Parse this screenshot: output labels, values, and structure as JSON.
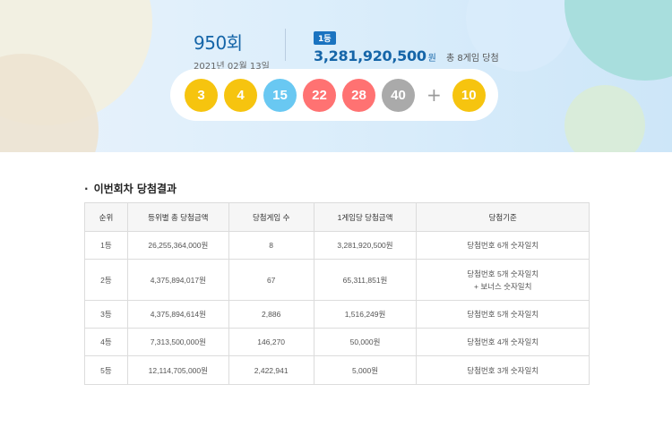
{
  "draw": {
    "round": "950회",
    "date": "2021년 02월 13일",
    "first_prize": {
      "badge": "1등",
      "amount": "3,281,920,500",
      "unit": "원",
      "winners_text": "총 8게임 당첨"
    },
    "numbers": [
      {
        "value": "3",
        "color": "yellow"
      },
      {
        "value": "4",
        "color": "yellow"
      },
      {
        "value": "15",
        "color": "blue"
      },
      {
        "value": "22",
        "color": "red"
      },
      {
        "value": "28",
        "color": "red"
      },
      {
        "value": "40",
        "color": "gray"
      }
    ],
    "plus": "+",
    "bonus": {
      "value": "10",
      "color": "yellow"
    }
  },
  "results": {
    "title": "이번회차 당첨결과",
    "headers": [
      "순위",
      "등위별 총 당첨금액",
      "당첨게임 수",
      "1게임당 당첨금액",
      "당첨기준"
    ],
    "rows": [
      {
        "rank": "1등",
        "total": "26,255,364,000원",
        "games": "8",
        "per_game": "3,281,920,500원",
        "criteria": "당첨번호 6개 숫자일치",
        "criteria2": ""
      },
      {
        "rank": "2등",
        "total": "4,375,894,017원",
        "games": "67",
        "per_game": "65,311,851원",
        "criteria": "당첨번호 5개 숫자일치",
        "criteria2": "+ 보너스 숫자일치"
      },
      {
        "rank": "3등",
        "total": "4,375,894,614원",
        "games": "2,886",
        "per_game": "1,516,249원",
        "criteria": "당첨번호 5개 숫자일치",
        "criteria2": ""
      },
      {
        "rank": "4등",
        "total": "7,313,500,000원",
        "games": "146,270",
        "per_game": "50,000원",
        "criteria": "당첨번호 4개 숫자일치",
        "criteria2": ""
      },
      {
        "rank": "5등",
        "total": "12,114,705,000원",
        "games": "2,422,941",
        "per_game": "5,000원",
        "criteria": "당첨번호 3개 숫자일치",
        "criteria2": ""
      }
    ]
  },
  "colors": {
    "yellow": "#f6c40f",
    "blue": "#69c8f2",
    "red": "#ff7272",
    "gray": "#aaaaaa",
    "accent": "#1565a8"
  }
}
